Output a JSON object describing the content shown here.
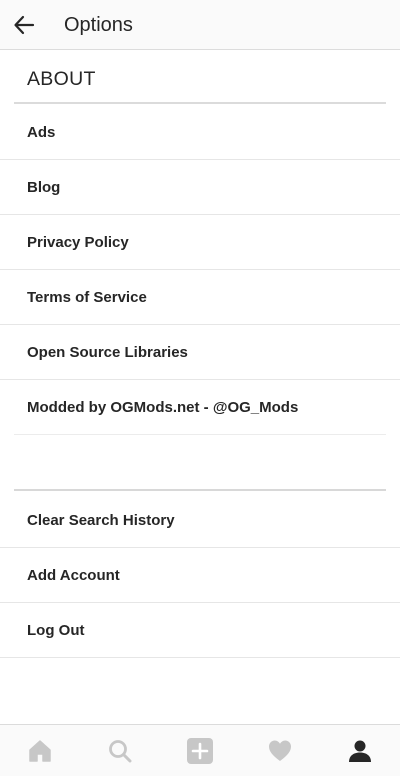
{
  "header": {
    "title": "Options",
    "back_icon": "arrow-left-icon"
  },
  "about_section": {
    "title": "ABOUT",
    "items": [
      {
        "label": "Ads"
      },
      {
        "label": "Blog"
      },
      {
        "label": "Privacy Policy"
      },
      {
        "label": "Terms of Service"
      },
      {
        "label": "Open Source Libraries"
      },
      {
        "label": "Modded by OGMods.net - @OG_Mods"
      }
    ]
  },
  "account_section": {
    "items": [
      {
        "label": "Clear Search History"
      },
      {
        "label": "Add Account"
      },
      {
        "label": "Log Out"
      }
    ]
  },
  "bottom_nav": {
    "items": [
      {
        "icon": "home-icon",
        "active": false
      },
      {
        "icon": "search-icon",
        "active": false
      },
      {
        "icon": "add-post-icon",
        "active": false
      },
      {
        "icon": "heart-icon",
        "active": false
      },
      {
        "icon": "profile-icon",
        "active": true
      }
    ],
    "inactive_color": "#c7c7c7",
    "active_color": "#262626"
  }
}
